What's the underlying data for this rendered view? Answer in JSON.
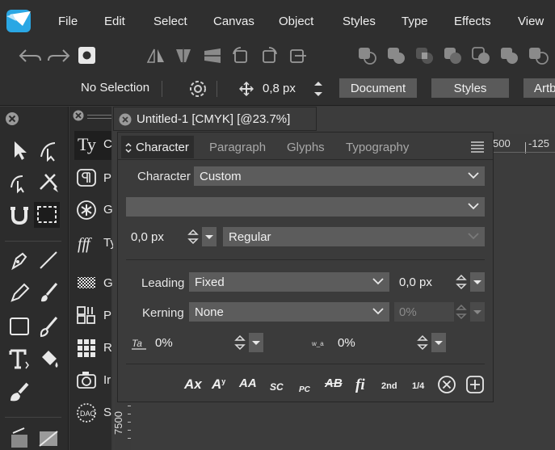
{
  "menu": {
    "items": [
      "File",
      "Edit",
      "Select",
      "Canvas",
      "Object",
      "Styles",
      "Type",
      "Effects",
      "View"
    ]
  },
  "context_bar": {
    "selection": "No Selection",
    "stroke_value": "0,8 px",
    "buttons": [
      "Document",
      "Styles",
      "Artb"
    ]
  },
  "document_tab": {
    "title": "Untitled-1 [CMYK] [@23.7%]"
  },
  "ruler": {
    "top_labels": [
      "500",
      "-125"
    ],
    "left_label": "7500"
  },
  "side_panel": {
    "items": [
      {
        "icon": "text-style-icon",
        "label": "C"
      },
      {
        "icon": "paragraph-style-icon",
        "label": "P"
      },
      {
        "icon": "glyph-star-icon",
        "label": "G"
      },
      {
        "icon": "typography-icon",
        "label": "Ty"
      },
      {
        "icon": "gradient-icon",
        "label": "G"
      },
      {
        "icon": "paragraph-grid-icon",
        "label": "P"
      },
      {
        "icon": "grid-dots-icon",
        "label": "R"
      },
      {
        "icon": "camera-icon",
        "label": "Ir"
      },
      {
        "icon": "stamp-icon",
        "label": "S"
      }
    ]
  },
  "character_panel": {
    "tabs": [
      "Character",
      "Paragraph",
      "Glyphs",
      "Typography"
    ],
    "active_tab": "Character",
    "character_label": "Character",
    "character_value": "Custom",
    "font_family_value": "",
    "font_size_value": "0,0 px",
    "font_style_value": "Regular",
    "leading_label": "Leading",
    "leading_value": "Fixed",
    "leading_amount": "0,0 px",
    "kerning_label": "Kerning",
    "kerning_value": "None",
    "kerning_amount": "0%",
    "tracking_value": "0%",
    "baseline_value": "0%",
    "bottom_buttons": [
      "Ax",
      "A",
      "AA",
      "SC",
      "PC",
      "AB",
      "fi",
      "2nd",
      "1/4"
    ]
  },
  "colors": {
    "background": "#3a3a3a",
    "bar": "#2f2f2f",
    "field": "#5c5c5c",
    "accent": "#2aa7e4"
  }
}
